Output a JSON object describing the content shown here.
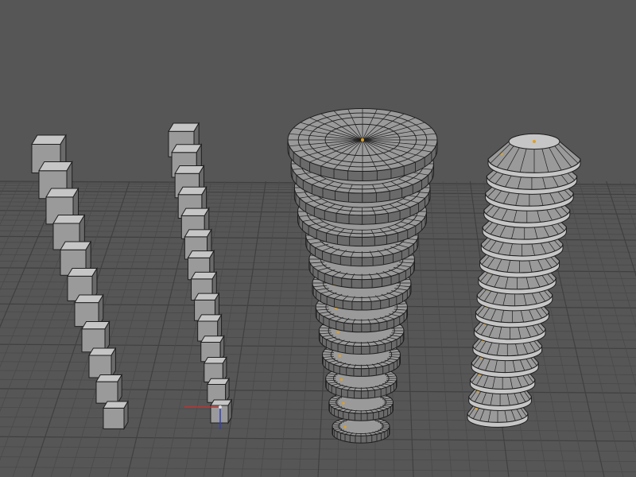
{
  "viewport": {
    "background_color": "#565656",
    "grid_color": "#4a4a4a",
    "grid_major_color": "#404040",
    "mesh_face_color": "#9a9a9a",
    "mesh_face_light": "#c6c6c6",
    "mesh_face_dark": "#6a6a6a",
    "mesh_edge_color": "#1e1e1e",
    "vertex_highlight_color": "#e0a020",
    "axis_x_color": "#c03030",
    "axis_y_color": "#3040c0"
  },
  "objects": [
    {
      "kind": "cube-column",
      "name": "cube-column-left",
      "cube_count": 11
    },
    {
      "kind": "cube-column",
      "name": "cube-column-right",
      "cube_count": 14
    },
    {
      "kind": "disc-tower",
      "name": "disc-tower-flat",
      "ring_count": 13
    },
    {
      "kind": "cone-tower",
      "name": "cone-tower-stacked",
      "ring_count": 16
    }
  ],
  "gizmo": {
    "icon": "transform-axis-icon"
  }
}
